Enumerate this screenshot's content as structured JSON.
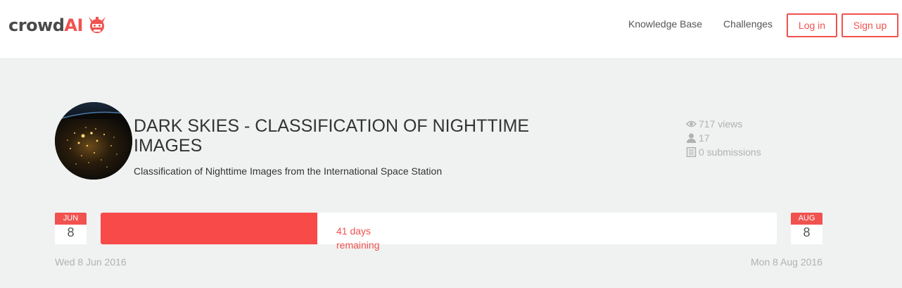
{
  "brand": {
    "part1": "crowd",
    "part2": "AI",
    "accent_color": "#f0524f",
    "icon": "samurai-mascot-icon"
  },
  "nav": {
    "knowledge_base": "Knowledge Base",
    "challenges": "Challenges",
    "login": "Log in",
    "signup": "Sign up"
  },
  "challenge": {
    "title": "DARK SKIES - CLASSIFICATION OF NIGHTTIME IMAGES",
    "subtitle": "Classification of Nighttime Images from the International Space Station",
    "image": "earth-at-night-from-space"
  },
  "stats": {
    "views": "717 views",
    "participants": "17",
    "submissions": "0 submissions"
  },
  "timeline": {
    "start_month": "JUN",
    "start_day": "8",
    "start_date": "Wed 8 Jun 2016",
    "end_month": "AUG",
    "end_day": "8",
    "end_date": "Mon 8 Aug 2016",
    "remaining_text": "41 days remaining",
    "progress_fraction": 0.32
  }
}
